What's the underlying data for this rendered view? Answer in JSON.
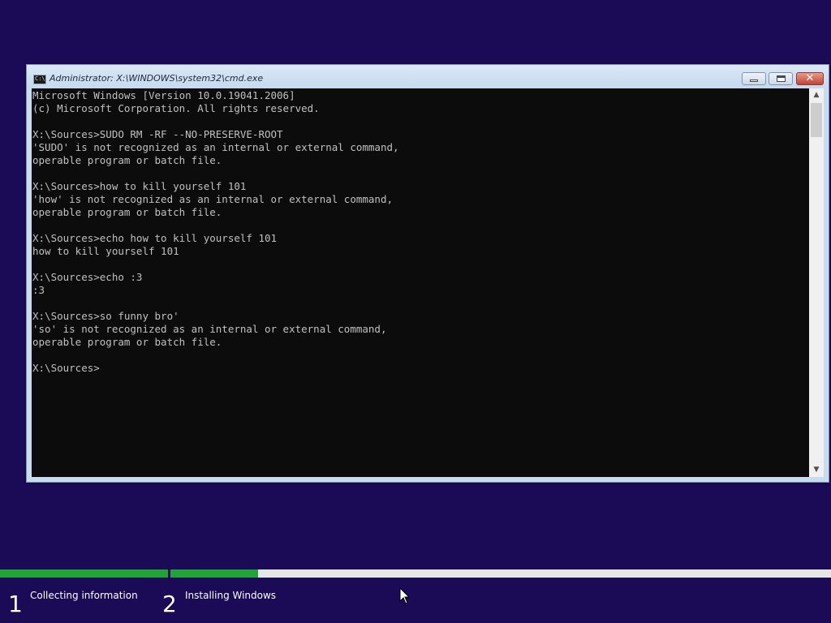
{
  "window": {
    "title": "Administrator: X:\\WINDOWS\\system32\\cmd.exe",
    "icon": "cmd-icon",
    "icon_text": "C:\\",
    "close_glyph": "✕"
  },
  "console": {
    "lines": [
      "Microsoft Windows [Version 10.0.19041.2006]",
      "(c) Microsoft Corporation. All rights reserved.",
      "",
      "X:\\Sources>SUDO RM -RF --NO-PRESERVE-ROOT",
      "'SUDO' is not recognized as an internal or external command,",
      "operable program or batch file.",
      "",
      "X:\\Sources>how to kill yourself 101",
      "'how' is not recognized as an internal or external command,",
      "operable program or batch file.",
      "",
      "X:\\Sources>echo how to kill yourself 101",
      "how to kill yourself 101",
      "",
      "X:\\Sources>echo :3",
      ":3",
      "",
      "X:\\Sources>so funny bro'",
      "'so' is not recognized as an internal or external command,",
      "operable program or batch file.",
      "",
      "X:\\Sources>"
    ],
    "colors": {
      "background": "#0c0c0c",
      "text": "#c0c0c0"
    }
  },
  "setup": {
    "steps": [
      {
        "number": "1",
        "label": "Collecting information",
        "progress": 1.0
      },
      {
        "number": "2",
        "label": "Installing Windows",
        "progress": 0.133
      }
    ],
    "colors": {
      "background": "#1b0a55",
      "progress_fill": "#21a33a",
      "progress_track": "#e6e6e6"
    }
  }
}
